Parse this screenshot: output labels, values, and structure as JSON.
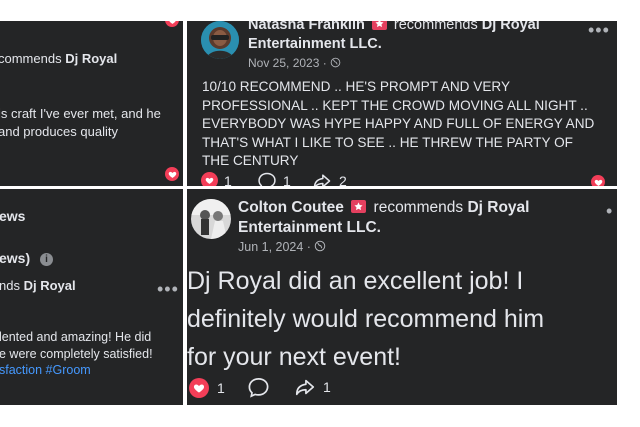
{
  "panel_top_left": {
    "header_text": "commends",
    "header_name": "Dj Royal",
    "body_line1": "is craft I've ever met, and he",
    "body_line2": "and produces quality"
  },
  "panel_top_right": {
    "author": "Natasha Franklin",
    "recommends": "recommends",
    "page_name_1": "Dj Royal",
    "page_name_2": "Entertainment LLC.",
    "date": "Nov 25, 2023 ·",
    "body_lines": [
      "10/10 RECOMMEND .. HE'S PROMPT AND VERY",
      "PROFESSIONAL .. KEPT THE CROWD MOVING ALL NIGHT ..",
      "EVERYBODY WAS HYPE HAPPY AND FULL OF ENERGY AND",
      "THAT'S WHAT I LIKE TO SEE .. HE THREW THE PARTY OF",
      "THE CENTURY"
    ],
    "like_count": "1",
    "comment_count": "1",
    "share_count": "2"
  },
  "panel_bottom_left": {
    "title": "ews",
    "subtitle": "ews)",
    "header_text": "nds",
    "header_name": "Dj Royal",
    "body_line1": "lented and amazing! He did",
    "body_line2": "e were completely satisfied!",
    "hashtags": "sfaction #Groom"
  },
  "panel_bottom_right": {
    "author": "Colton Coutee",
    "recommends": "recommends",
    "page_name_1": "Dj Royal",
    "page_name_2": "Entertainment LLC.",
    "date": "Jun 1, 2024 ·",
    "body_lines": [
      "Dj Royal did an excellent job! I",
      "definitely would recommend him",
      "for your next event!"
    ],
    "like_count": "1",
    "share_count": "1"
  },
  "icons": {
    "heart": "heart-icon",
    "comment": "comment-icon",
    "share": "share-icon",
    "globe": "globe-icon",
    "info": "info-icon",
    "more": "more-options-icon"
  },
  "colors": {
    "panel_bg": "#242526",
    "text": "#e4e6eb",
    "muted": "#b0b3b8",
    "heart": "#f33e58",
    "badge": "#e4405f",
    "hashtag": "#4599ff"
  }
}
